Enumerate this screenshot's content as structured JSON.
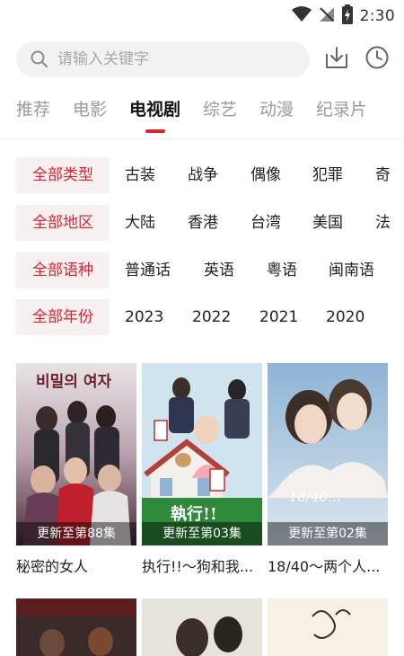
{
  "status_bar": {
    "time": "2:30"
  },
  "search": {
    "placeholder": "请输入关键字"
  },
  "tabs": [
    {
      "label": "推荐"
    },
    {
      "label": "电影"
    },
    {
      "label": "电视剧",
      "active": true
    },
    {
      "label": "综艺"
    },
    {
      "label": "动漫"
    },
    {
      "label": "纪录片"
    }
  ],
  "filters": {
    "type": {
      "all": "全部类型",
      "options": [
        "古装",
        "战争",
        "偶像",
        "犯罪",
        "奇"
      ]
    },
    "region": {
      "all": "全部地区",
      "options": [
        "大陆",
        "香港",
        "台湾",
        "美国",
        "法"
      ]
    },
    "language": {
      "all": "全部语种",
      "options": [
        "普通话",
        "英语",
        "粤语",
        "闽南语"
      ]
    },
    "year": {
      "all": "全部年份",
      "options": [
        "2023",
        "2022",
        "2021",
        "2020"
      ]
    }
  },
  "cards": [
    {
      "title": "秘密的女人",
      "badge": "更新至第88集",
      "poster_text": "비밀의 여자"
    },
    {
      "title": "执行!!～狗和我...",
      "badge": "更新至第03集",
      "poster_text": "執行!!"
    },
    {
      "title": "18/40～两个人...",
      "badge": "更新至第02集",
      "poster_text": "18/40..."
    }
  ],
  "colors": {
    "accent": "#e02232",
    "filter_bg": "#f6f0f0",
    "search_bg": "#f2f2f2"
  },
  "icons": [
    "wifi-icon",
    "signal-icon",
    "battery-icon",
    "search-icon",
    "download-icon",
    "history-clock-icon"
  ]
}
